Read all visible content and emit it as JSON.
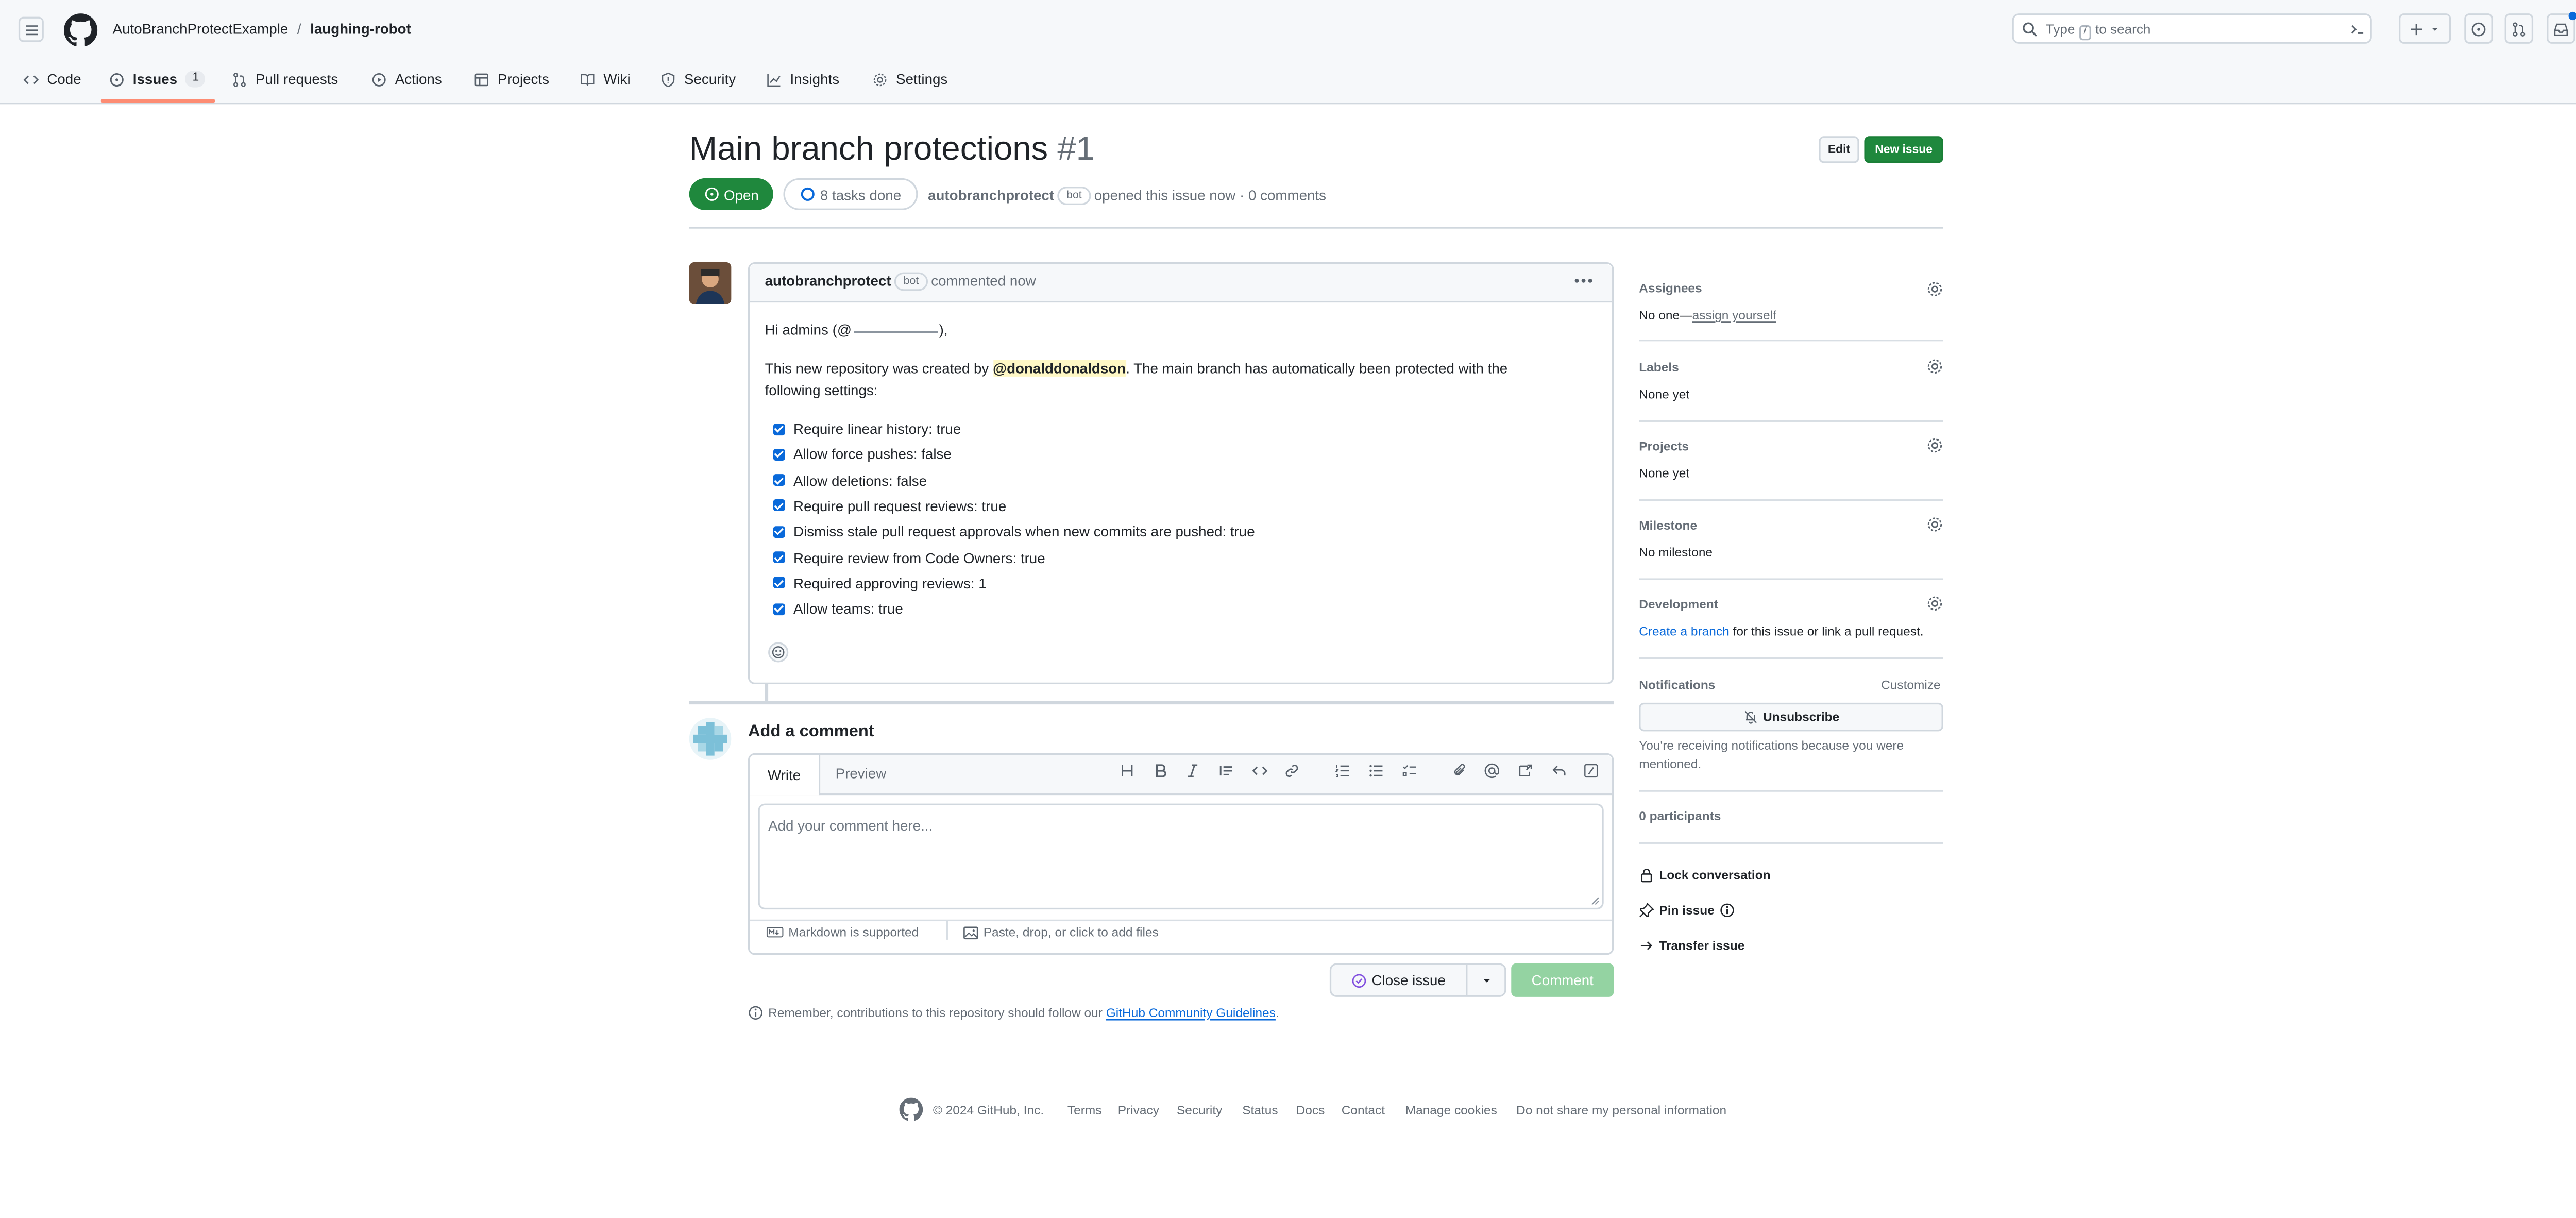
{
  "header": {
    "owner": "AutoBranchProtectExample",
    "separator": "/",
    "repo": "laughing-robot",
    "search_text_before": "Type",
    "search_key": "/",
    "search_text_after": "to search"
  },
  "repo_nav": [
    {
      "label": "Code",
      "icon": "code-icon"
    },
    {
      "label": "Issues",
      "icon": "issue-opened-icon",
      "count": "1",
      "selected": true
    },
    {
      "label": "Pull requests",
      "icon": "git-pull-request-icon"
    },
    {
      "label": "Actions",
      "icon": "play-icon"
    },
    {
      "label": "Projects",
      "icon": "table-icon"
    },
    {
      "label": "Wiki",
      "icon": "book-icon"
    },
    {
      "label": "Security",
      "icon": "shield-icon"
    },
    {
      "label": "Insights",
      "icon": "graph-icon"
    },
    {
      "label": "Settings",
      "icon": "gear-icon"
    }
  ],
  "issue": {
    "title": "Main branch protections",
    "number": "#1",
    "edit_label": "Edit",
    "new_issue_label": "New issue",
    "state": "Open",
    "tasks": "8 tasks done",
    "author": "autobranchprotect",
    "author_badge": "bot",
    "opened_text": "opened this issue now",
    "dot": "·",
    "comments_count": "0 comments"
  },
  "comment": {
    "author": "autobranchprotect",
    "badge": "bot",
    "time": "commented now",
    "greeting_before": "Hi admins (@",
    "greeting_after": "),",
    "body_before": "This new repository was created by",
    "mention": "@donalddonaldson",
    "body_after": ". The main branch has automatically been protected with the following settings:",
    "tasks": [
      "Require linear history: true",
      "Allow force pushes: false",
      "Allow deletions: false",
      "Require pull request reviews: true",
      "Dismiss stale pull request approvals when new commits are pushed: true",
      "Require review from Code Owners: true",
      "Required approving reviews: 1",
      "Allow teams: true"
    ]
  },
  "composer": {
    "heading": "Add a comment",
    "tab_write": "Write",
    "tab_preview": "Preview",
    "placeholder": "Add your comment here...",
    "markdown_note": "Markdown is supported",
    "attach_note": "Paste, drop, or click to add files",
    "close_issue": "Close issue",
    "comment_button": "Comment",
    "notice_before": "Remember, contributions to this repository should follow our",
    "notice_link": "GitHub Community Guidelines",
    "notice_after": "."
  },
  "sidebar": {
    "assignees_title": "Assignees",
    "assignees_value": "No one—",
    "assign_yourself": "assign yourself",
    "labels_title": "Labels",
    "labels_value": "None yet",
    "projects_title": "Projects",
    "projects_value": "None yet",
    "milestone_title": "Milestone",
    "milestone_value": "No milestone",
    "development_title": "Development",
    "development_link": "Create a branch",
    "development_text": "for this issue or link a pull request.",
    "notifications_title": "Notifications",
    "customize": "Customize",
    "unsubscribe": "Unsubscribe",
    "notify_reason": "You're receiving notifications because you were mentioned.",
    "participants": "0 participants",
    "lock": "Lock conversation",
    "pin": "Pin issue",
    "transfer": "Transfer issue"
  },
  "footer": {
    "copyright": "© 2024 GitHub, Inc.",
    "links": [
      "Terms",
      "Privacy",
      "Security",
      "Status",
      "Docs",
      "Contact",
      "Manage cookies",
      "Do not share my personal information"
    ]
  },
  "colors": {
    "open_green": "#1f883d",
    "link_blue": "#0969da",
    "tab_underline": "#fd8c73",
    "comment_button_disabled": "#94d3a2"
  }
}
